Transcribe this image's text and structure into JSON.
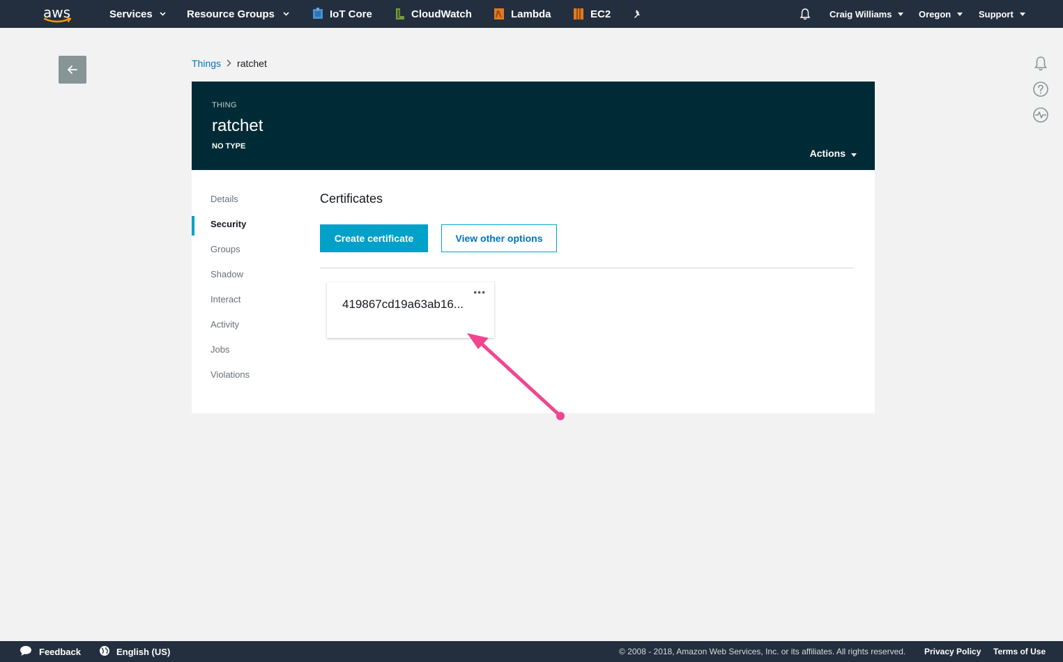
{
  "topnav": {
    "logo": "aws",
    "services": "Services",
    "resource_groups": "Resource Groups",
    "iot_core": "IoT Core",
    "cloudwatch": "CloudWatch",
    "lambda": "Lambda",
    "ec2": "EC2",
    "user": "Craig Williams",
    "region": "Oregon",
    "support": "Support",
    "icons": [
      "bell-icon",
      "pin-icon"
    ]
  },
  "breadcrumb": {
    "parent": "Things",
    "current": "ratchet"
  },
  "header": {
    "label": "THING",
    "name": "ratchet",
    "type": "NO TYPE",
    "actions": "Actions"
  },
  "sidenav": {
    "items": [
      {
        "label": "Details"
      },
      {
        "label": "Security",
        "active": true
      },
      {
        "label": "Groups"
      },
      {
        "label": "Shadow"
      },
      {
        "label": "Interact"
      },
      {
        "label": "Activity"
      },
      {
        "label": "Jobs"
      },
      {
        "label": "Violations"
      }
    ]
  },
  "main": {
    "title": "Certificates",
    "create_button": "Create certificate",
    "other_options_button": "View other options",
    "certificate": {
      "id": "419867cd19a63ab16...",
      "menu": "•••"
    }
  },
  "footer": {
    "feedback": "Feedback",
    "language": "English (US)",
    "copyright": "© 2008 - 2018, Amazon Web Services, Inc. or its affiliates. All rights reserved.",
    "privacy": "Privacy Policy",
    "terms": "Terms of Use"
  },
  "colors": {
    "nav_bg": "#232f3e",
    "header_bg": "#002b36",
    "accent": "#00a1c9",
    "link": "#0073bb",
    "annotation": "#f1468f"
  }
}
